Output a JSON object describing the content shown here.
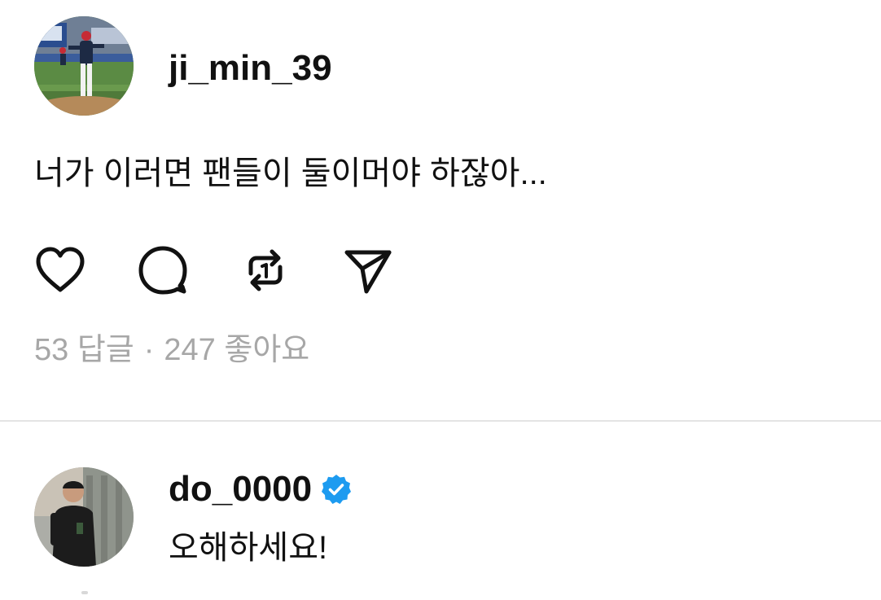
{
  "post": {
    "username": "ji_min_39",
    "text": "너가 이러면 팬들이 둘이머야 하잖아...",
    "replies_count": "53 답글",
    "separator": "·",
    "likes_count": "247 좋아요",
    "actions": [
      {
        "icon": "heart-icon"
      },
      {
        "icon": "comment-icon"
      },
      {
        "icon": "repost-icon"
      },
      {
        "icon": "share-icon"
      }
    ]
  },
  "reply": {
    "username": "do_0000",
    "verified_icon": "verified-badge-icon",
    "text": "오해하세요!"
  },
  "colors": {
    "text": "#111111",
    "muted": "#a7a7a7",
    "divider": "#e4e4e4",
    "verified": "#1d9bf0",
    "background": "#ffffff"
  }
}
